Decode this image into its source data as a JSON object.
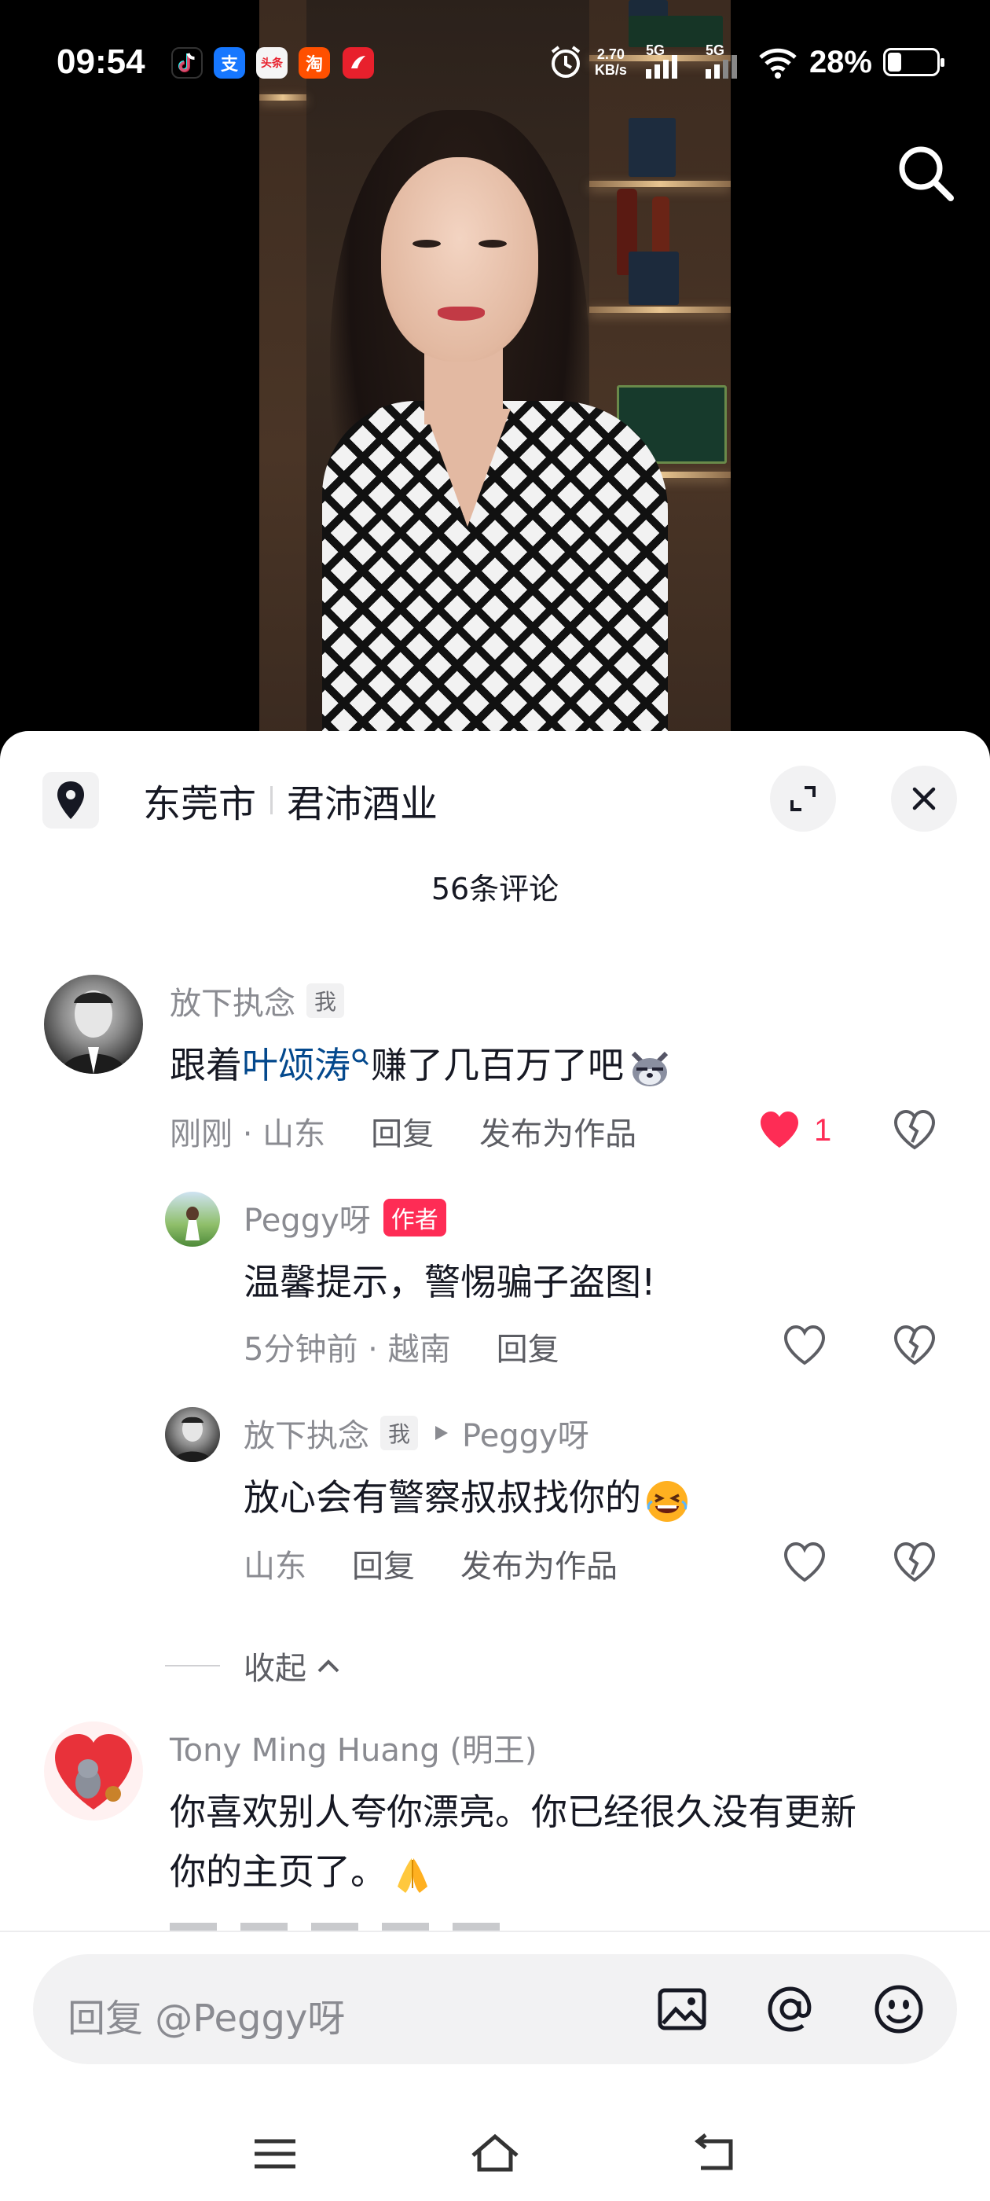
{
  "status_bar": {
    "time": "09:54",
    "net_speed_value": "2.70",
    "net_speed_unit": "KB/s",
    "signal_1": "5G",
    "signal_2": "5G",
    "battery_pct": "28%",
    "battery_level": 0.28,
    "notification_apps": [
      "tiktok-icon",
      "alipay-icon",
      "toutiao-icon",
      "taobao-icon",
      "ifeng-icon"
    ],
    "toutiao_text": "头条"
  },
  "location": {
    "city": "东莞市",
    "shop": "君沛酒业"
  },
  "comments_count": "56条评论",
  "comments": [
    {
      "user": "放下执念",
      "tag": "我",
      "text_before": "跟着",
      "mention": "叶颂涛",
      "text_after": "赚了几百万了吧",
      "time": "刚刚 · 山东",
      "reply": "回复",
      "publish": "发布为作品",
      "likes": "1",
      "liked": true
    },
    {
      "user": "Peggy呀",
      "tag": "作者",
      "text": "温馨提示，警惕骗子盗图!",
      "time": "5分钟前 · 越南",
      "reply": "回复"
    },
    {
      "user": "放下执念",
      "tag": "我",
      "reply_to": "Peggy呀",
      "text": "放心会有警察叔叔找你的",
      "time": "山东",
      "reply": "回复",
      "publish": "发布为作品"
    },
    {
      "user": "Tony Ming Huang (明王)",
      "text_line1": "你喜欢别人夸你漂亮。你已经很久没有更新",
      "text_line2": "你的主页了。"
    }
  ],
  "collapse_label": "收起",
  "input": {
    "placeholder": "回复 @Peggy呀"
  },
  "colors": {
    "accent": "#fe2c55",
    "mention": "#04498d",
    "muted": "#8a8b91"
  }
}
